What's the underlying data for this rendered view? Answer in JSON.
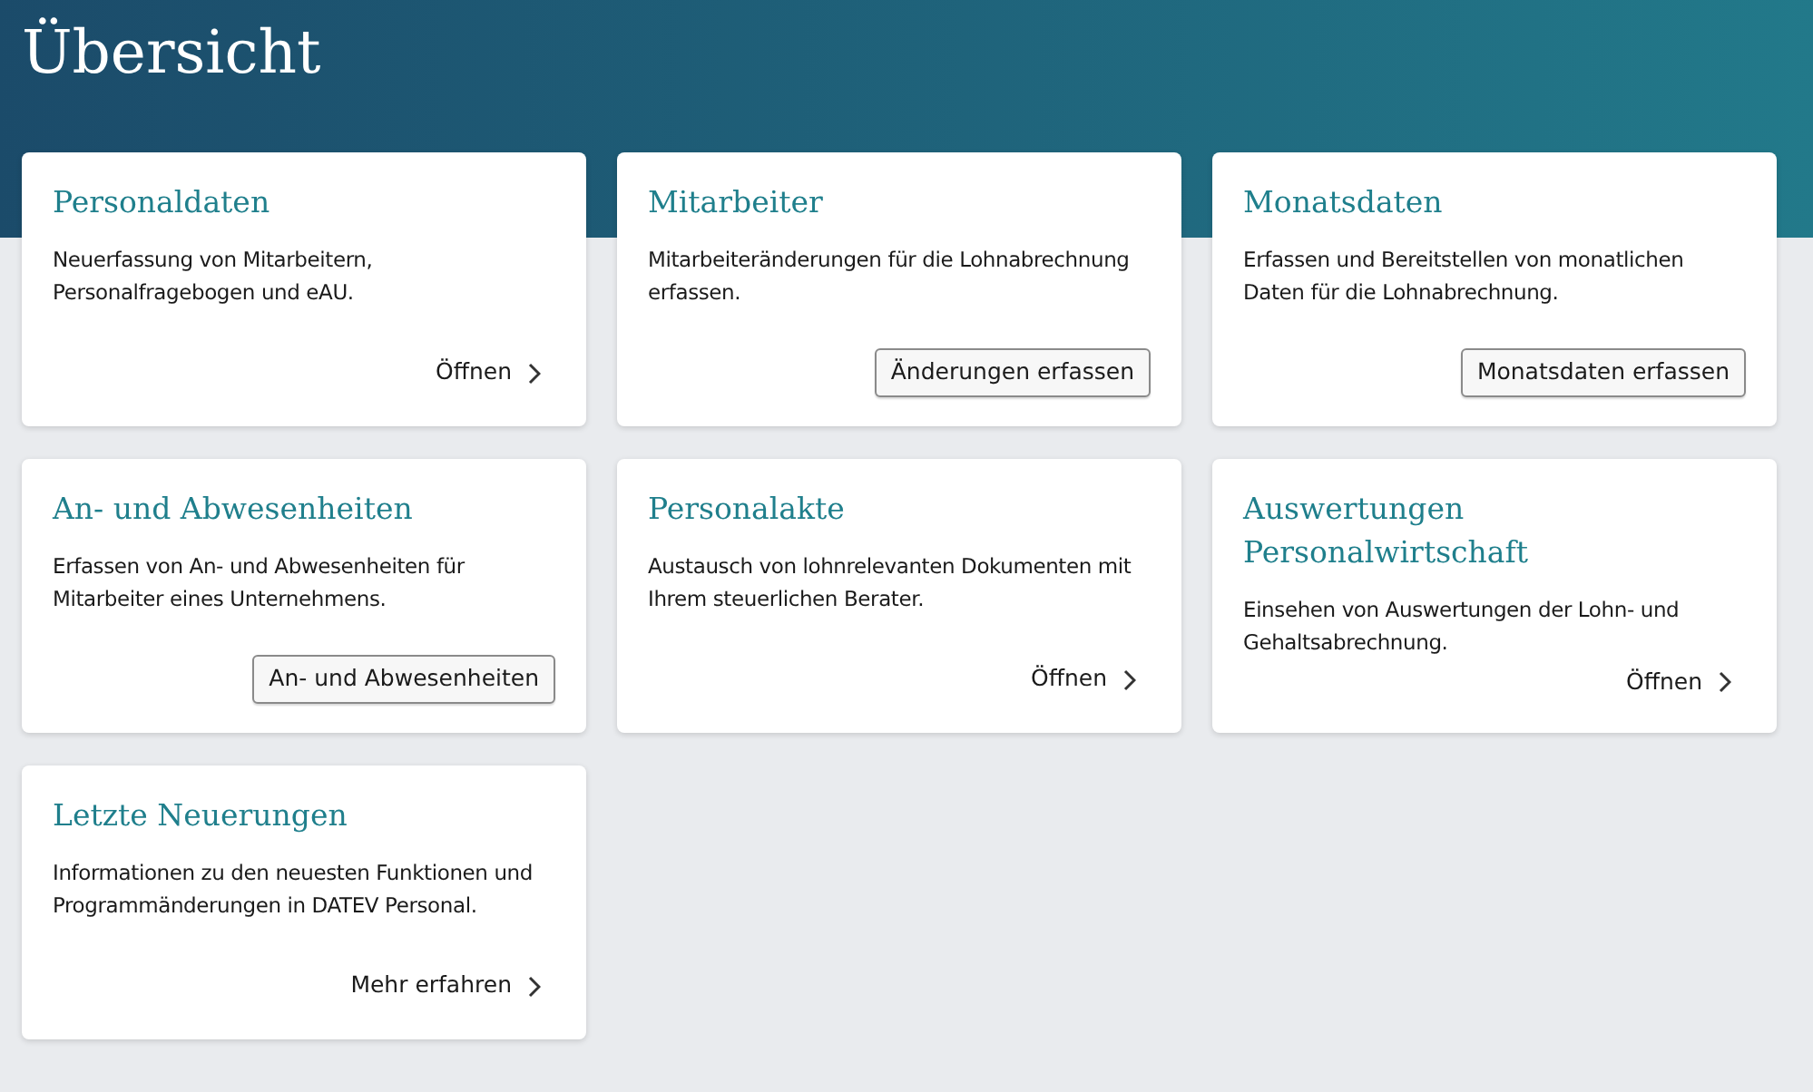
{
  "page": {
    "title": "Übersicht"
  },
  "cards": [
    {
      "title": "Personaldaten",
      "description": "Neuerfassung von Mitarbeitern, Personalfragebogen und eAU.",
      "action": {
        "kind": "link",
        "label": "Öffnen"
      }
    },
    {
      "title": "Mitarbeiter",
      "description": "Mitarbeiteränderungen für die Lohnabrechnung erfassen.",
      "action": {
        "kind": "button",
        "label": "Änderungen erfassen"
      }
    },
    {
      "title": "Monatsdaten",
      "description": "Erfassen und Bereitstellen von monatlichen Daten für die Lohnabrechnung.",
      "action": {
        "kind": "button",
        "label": "Monatsdaten erfassen"
      }
    },
    {
      "title": "An- und Abwesenheiten",
      "description": "Erfassen von An- und Abwesenheiten für Mitarbeiter eines Unternehmens.",
      "action": {
        "kind": "button",
        "label": "An- und Abwesenheiten"
      }
    },
    {
      "title": "Personalakte",
      "description": "Austausch von lohnrelevanten Dokumenten mit Ihrem steuerlichen Berater.",
      "action": {
        "kind": "link",
        "label": "Öffnen"
      }
    },
    {
      "title": "Auswertungen Personalwirtschaft",
      "description": "Einsehen von Auswertungen der Lohn- und Gehaltsabrechnung.",
      "action": {
        "kind": "link",
        "label": "Öffnen"
      }
    },
    {
      "title": "Letzte Neuerungen",
      "description": "Informationen zu den neuesten Funktionen und Programmänderungen in DATEV Personal.",
      "action": {
        "kind": "link",
        "label": "Mehr erfahren"
      }
    }
  ]
}
